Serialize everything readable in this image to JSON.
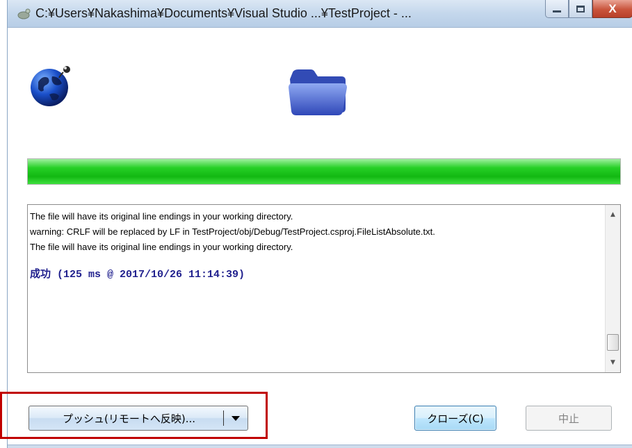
{
  "window": {
    "title": "C:¥Users¥Nakashima¥Documents¥Visual Studio ...¥TestProject - ...",
    "controls": {
      "minimize_icon": "minimize-icon",
      "maximize_icon": "maximize-icon",
      "close_label": "X"
    }
  },
  "icons": {
    "title": "tortoise-icon",
    "remote": "globe-icon",
    "local": "folder-icon"
  },
  "progress": {
    "fraction": 1.0,
    "color": "#1ec81e"
  },
  "log": {
    "lines": [
      "The file will have its original line endings in your working directory.",
      "warning: CRLF will be replaced by LF in TestProject/obj/Debug/TestProject.csproj.FileListAbsolute.txt.",
      "The file will have its original line endings in your working directory."
    ],
    "result": "成功  (125 ms @ 2017/10/26 11:14:39)",
    "result_color": "#21218e"
  },
  "buttons": {
    "push_label": "プッシュ(リモートへ反映)...",
    "close_label": "クローズ(C)",
    "abort_label": "中止"
  },
  "colors": {
    "highlight": "#c00000"
  }
}
